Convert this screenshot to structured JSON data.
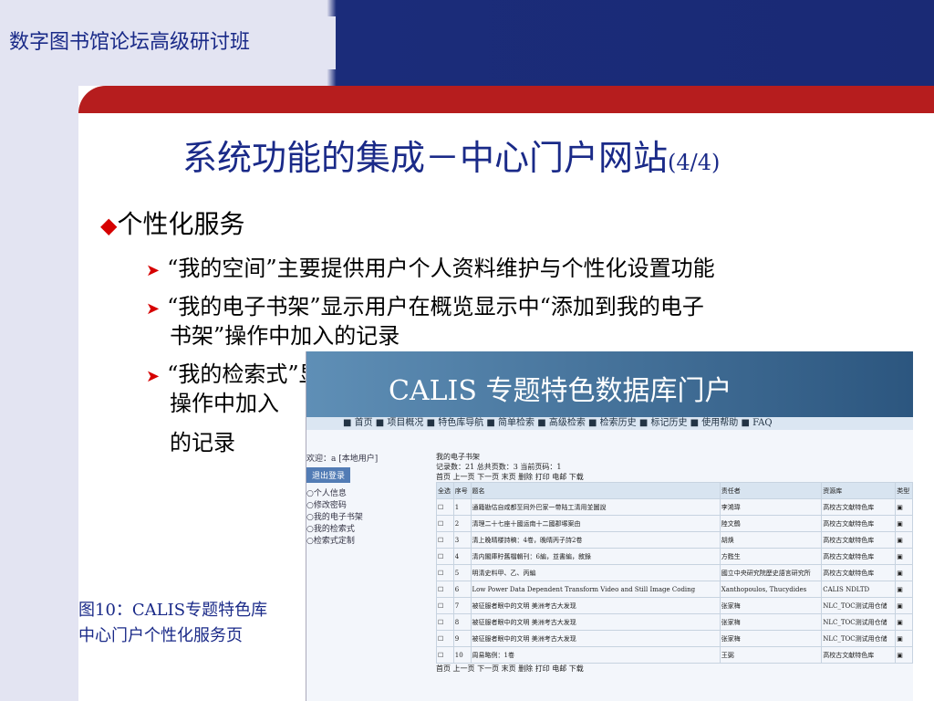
{
  "header": {
    "title": "数字图书馆论坛高级研讨班"
  },
  "slide": {
    "title": "系统功能的集成－中心门户网站",
    "page": "(4/4)",
    "bullet": "个性化服务",
    "items": [
      "“我的空间”主要提供用户个人资料维护与个性化设置功能",
      "“我的电子书架”显示用户在概览显示中“添加到我的电子",
      "书架”操作中加入的记录",
      "“我的检索式”显示用户在概览显示中“加入我的检索式”",
      "操作中加入",
      "的记录"
    ]
  },
  "caption": {
    "line1": "图10：CALIS专题特色库",
    "line2": "中心门户个性化服务页"
  },
  "calis": {
    "title": "CALIS 专题特色数据库门户",
    "nav": "■ 首页 ■ 项目概况 ■ 特色库导航 ■ 简单检索 ■ 高级检索 ■ 检索历史 ■ 标记历史 ■ 使用帮助 ■ FAQ",
    "welcome": "欢迎：a [本地用户]",
    "logout": "退出登录",
    "side": [
      "个人信息",
      "修改密码",
      "我的电子书架",
      "我的检索式",
      "检索式定制"
    ],
    "shelf": "我的电子书架",
    "stats": "记录数：21 总共页数：3 当前页码：1",
    "pager": "首页 上一页 下一页 末页  删除 打印 电邮 下载",
    "cols": [
      "全选",
      "序号",
      "题名",
      "责任者",
      "资源库",
      "类型"
    ],
    "rows": [
      [
        "1",
        "通籍勘估自咸都至同外巴家一带陆工清用並圖說",
        "李鴻瑋",
        "高校古文献特色库"
      ],
      [
        "2",
        "清理二十七座十國运南十二國郡塚案由",
        "陸文鶴",
        "高校古文献特色库"
      ],
      [
        "3",
        "清上晚晴楼詩稿：4卷，晚晴丙子詩2卷",
        "胡焕",
        "高校古文献特色库"
      ],
      [
        "4",
        "清内閣庫貯舊檔輯刊：6編，並書編，敘錄",
        "方甦生",
        "高校古文献特色库"
      ],
      [
        "5",
        "明清史料甲、乙、丙編",
        "國立中央研究院歷史語言研究所",
        "高校古文献特色库"
      ],
      [
        "6",
        "Low Power Data Dependent Transform Video and Still Image Coding",
        "Xanthopoulos, Thucydides",
        "CALIS NDLTD"
      ],
      [
        "7",
        "被征服者眼中的文明 美洲考古大发现",
        "张家梅",
        "NLC_TOC测试用仓储"
      ],
      [
        "8",
        "被征服者眼中的文明 美洲考古大发现",
        "张家梅",
        "NLC_TOC测试用仓储"
      ],
      [
        "9",
        "被征服者眼中的文明 美洲考古大发现",
        "张家梅",
        "NLC_TOC测试用仓储"
      ],
      [
        "10",
        "周易略例：1卷",
        "王弼",
        "高校古文献特色库"
      ]
    ]
  }
}
